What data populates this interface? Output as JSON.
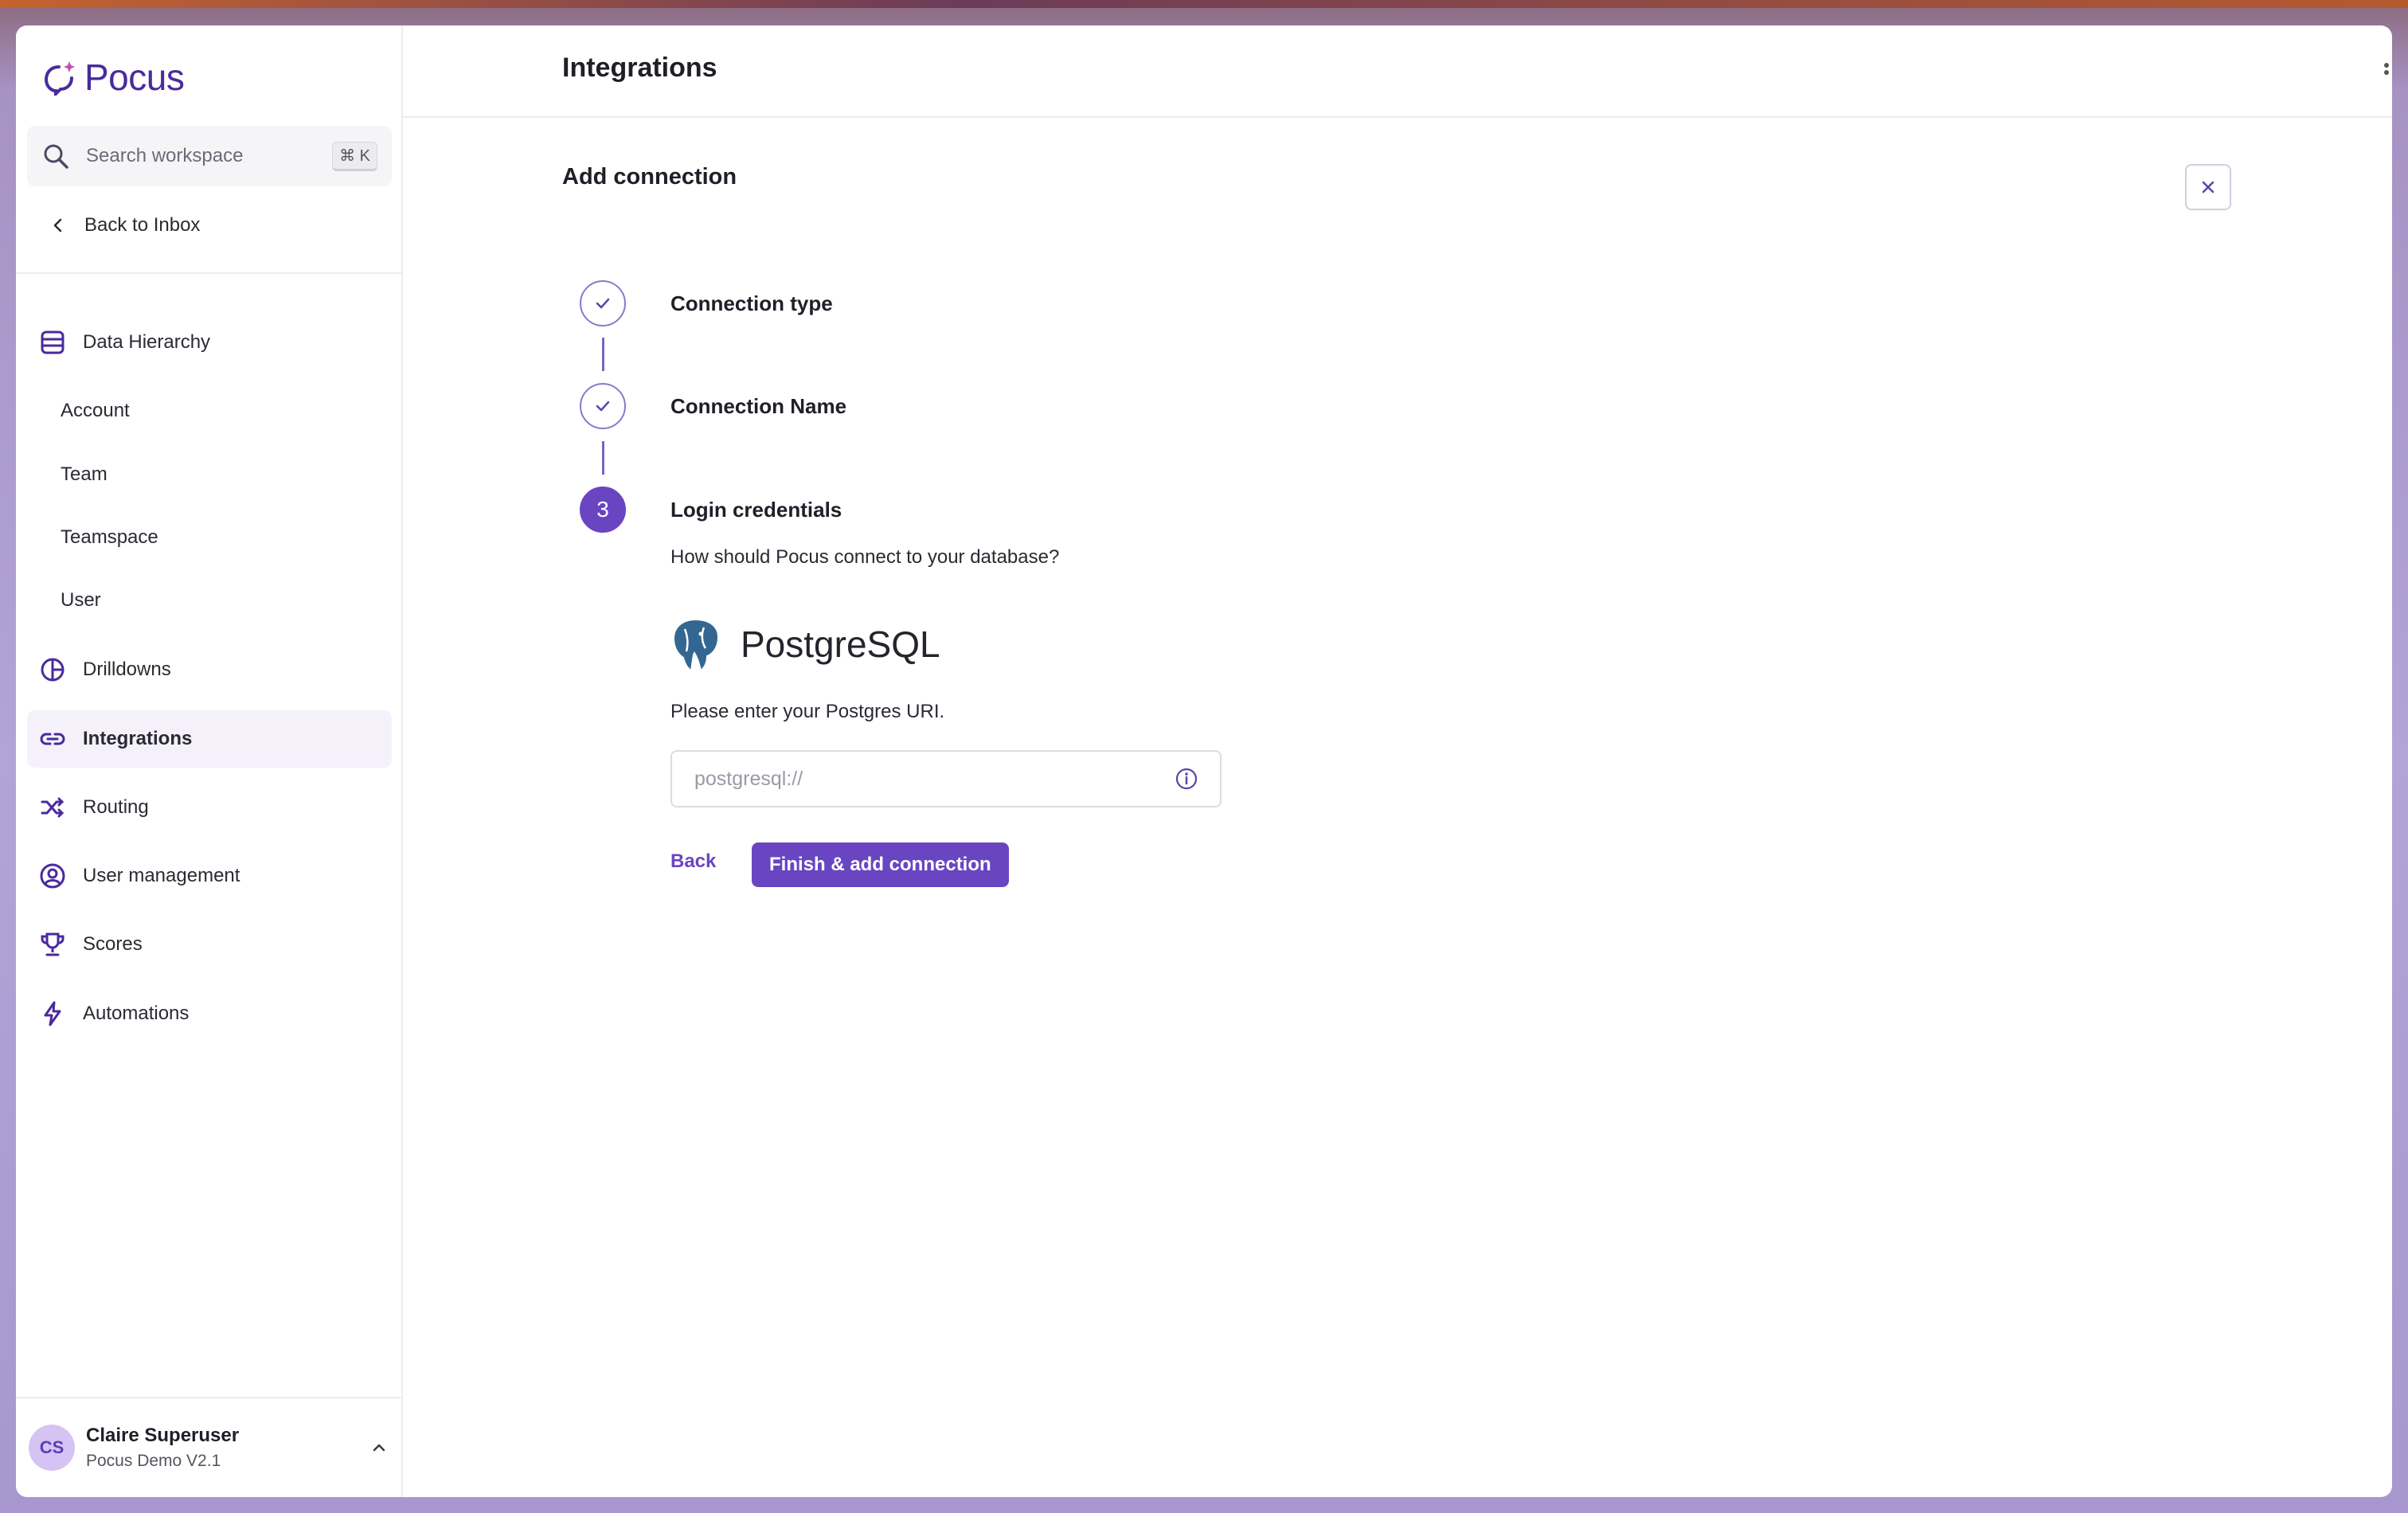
{
  "app": {
    "name": "Pocus"
  },
  "colors": {
    "accent": "#6a45c2",
    "brand": "#4a2a9e",
    "active_bg": "#f4f1fb"
  },
  "sidebar": {
    "search_placeholder": "Search workspace",
    "search_shortcut": "⌘ K",
    "back_label": "Back to Inbox",
    "nav": [
      {
        "label": "Data Hierarchy",
        "icon": "database-icon"
      },
      {
        "label": "Drilldowns",
        "icon": "pie-chart-icon"
      },
      {
        "label": "Integrations",
        "icon": "link-icon",
        "active": true
      },
      {
        "label": "Routing",
        "icon": "shuffle-icon"
      },
      {
        "label": "User management",
        "icon": "user-circle-icon"
      },
      {
        "label": "Scores",
        "icon": "trophy-icon"
      },
      {
        "label": "Automations",
        "icon": "bolt-icon"
      }
    ],
    "data_hierarchy_items": [
      "Account",
      "Team",
      "Teamspace",
      "User"
    ],
    "user": {
      "initials": "CS",
      "name": "Claire Superuser",
      "org": "Pocus Demo V2.1"
    }
  },
  "main": {
    "page_title": "Integrations",
    "section_title": "Add connection",
    "steps": [
      {
        "label": "Connection type",
        "state": "done"
      },
      {
        "label": "Connection Name",
        "state": "done"
      },
      {
        "label": "Login credentials",
        "state": "current",
        "number": "3"
      }
    ],
    "question": "How should Pocus connect to your database?",
    "provider_name": "PostgreSQL",
    "uri_prompt": "Please enter your Postgres URI.",
    "uri_placeholder": "postgresql://",
    "uri_value": "",
    "back_button": "Back",
    "finish_button": "Finish & add connection"
  }
}
